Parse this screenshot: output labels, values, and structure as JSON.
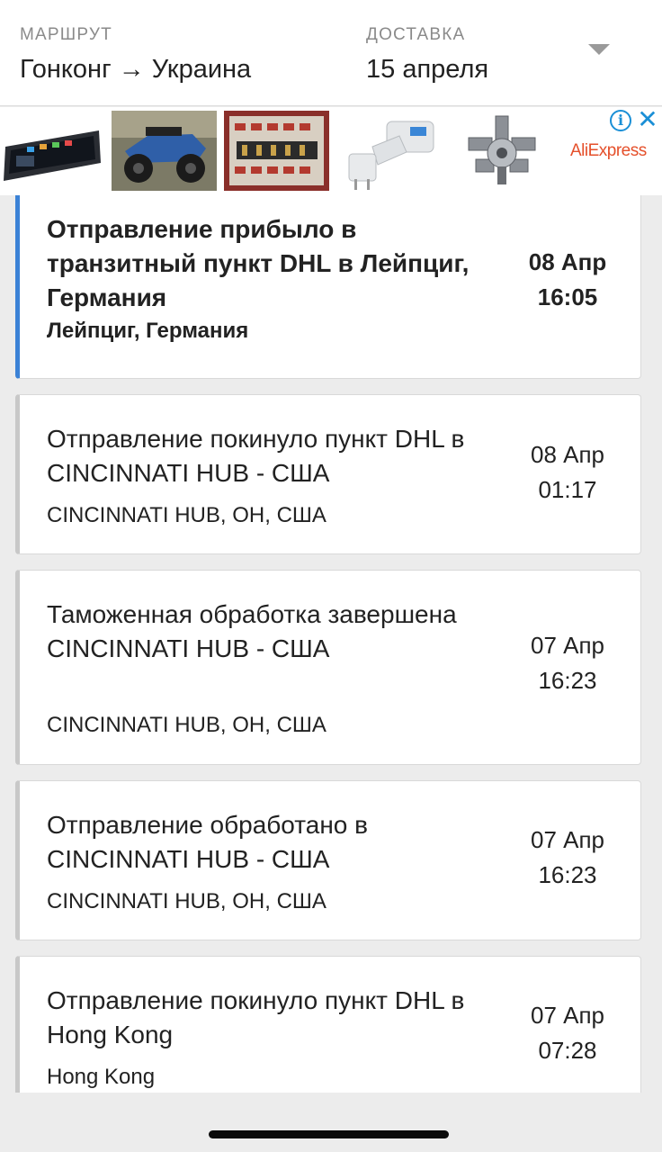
{
  "header": {
    "route_label": "МАРШРУТ",
    "route_value": "Гонконг → Украина",
    "delivery_label": "ДОСТАВКА",
    "delivery_value": "15 апреля"
  },
  "ad": {
    "brand": "AliExpress",
    "info_icon": "info-icon",
    "close_icon": "close-icon",
    "products": [
      "car-dvr-mirror",
      "rc-buggy-car",
      "amplifier-board",
      "power-socket-adapter",
      "radial-engine-model"
    ]
  },
  "events": [
    {
      "title": "Отправление прибыло в транзитный пункт DHL в Лейпциг, Германия",
      "location": "Лейпциг, Германия",
      "date": "08 Апр",
      "time": "16:05",
      "active": true
    },
    {
      "title": "Отправление покинуло пункт DHL в CINCINNATI HUB - США",
      "location": "CINCINNATI HUB, OH, США",
      "date": "08 Апр",
      "time": "01:17",
      "active": false
    },
    {
      "title": "Таможенная обработка завершена CINCINNATI HUB - США",
      "location": "CINCINNATI HUB, OH, США",
      "date": "07 Апр",
      "time": "16:23",
      "active": false
    },
    {
      "title": "Отправление обработано в CINCINNATI HUB - США",
      "location": "CINCINNATI HUB, OH, США",
      "date": "07 Апр",
      "time": "16:23",
      "active": false
    },
    {
      "title": "Отправление покинуло пункт DHL в Hong Kong",
      "location": "Hong Kong",
      "date": "07 Апр",
      "time": "07:28",
      "active": false
    }
  ],
  "colors": {
    "accent": "#3b82d6",
    "ad_brand": "#e5502b",
    "ad_icons": "#1a8fd6"
  }
}
